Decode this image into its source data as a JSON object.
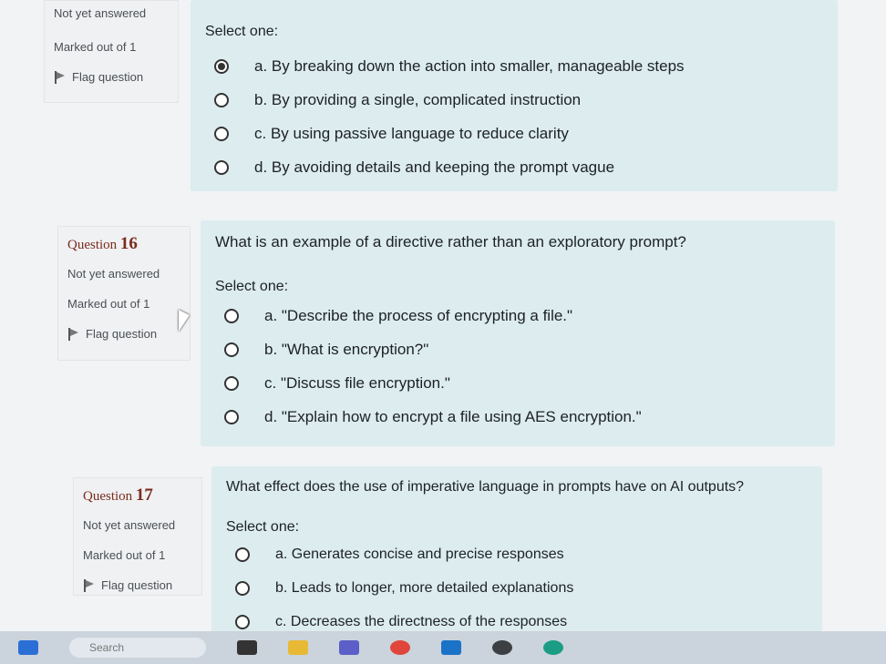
{
  "q15": {
    "state": "Not yet answered",
    "mark": "Marked out of 1",
    "flag": "Flag question",
    "prompt": "Select one:",
    "options": [
      {
        "label": "a. By breaking down the action into smaller, manageable steps",
        "checked": true
      },
      {
        "label": "b. By providing a single, complicated instruction",
        "checked": false
      },
      {
        "label": "c. By using passive language to reduce clarity",
        "checked": false
      },
      {
        "label": "d. By avoiding details and keeping the prompt vague",
        "checked": false
      }
    ]
  },
  "q16": {
    "qword": "Question",
    "number": "16",
    "state": "Not yet answered",
    "mark": "Marked out of 1",
    "flag": "Flag question",
    "text": "What is an example of a directive rather than an exploratory prompt?",
    "prompt": "Select one:",
    "options": [
      {
        "label": "a. \"Describe the process of encrypting a file.\"",
        "checked": false
      },
      {
        "label": "b. \"What is encryption?\"",
        "checked": false
      },
      {
        "label": "c. \"Discuss file encryption.\"",
        "checked": false
      },
      {
        "label": "d. \"Explain how to encrypt a file using AES encryption.\"",
        "checked": false
      }
    ]
  },
  "q17": {
    "qword": "Question",
    "number": "17",
    "state": "Not yet answered",
    "mark": "Marked out of 1",
    "flag": "Flag question",
    "text": "What effect does the use of imperative language in prompts have on AI outputs?",
    "prompt": "Select one:",
    "options": [
      {
        "label": "a. Generates concise and precise responses",
        "checked": false
      },
      {
        "label": "b. Leads to longer, more detailed explanations",
        "checked": false
      },
      {
        "label": "c. Decreases the directness of the responses",
        "checked": false
      }
    ]
  },
  "taskbar": {
    "search_placeholder": "Search"
  }
}
